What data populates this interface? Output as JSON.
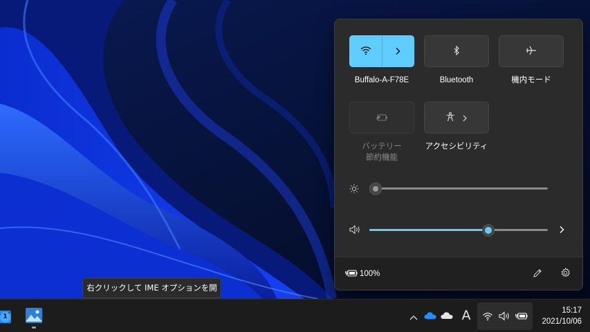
{
  "quick_settings": {
    "tiles": {
      "wifi": {
        "label": "Buffalo-A-F78E",
        "state": "on"
      },
      "bluetooth": {
        "label": "Bluetooth",
        "state": "off"
      },
      "airplane": {
        "label": "機内モード",
        "state": "off"
      },
      "battery_saver": {
        "label_line1": "バッテリー",
        "label_line2": "節約機能",
        "state": "disabled"
      },
      "accessibility": {
        "label": "アクセシビリティ",
        "state": "off"
      }
    },
    "brightness": {
      "level": 0
    },
    "volume": {
      "level": 0.68
    },
    "battery": {
      "percent": "100%"
    }
  },
  "tooltip": {
    "text": "右クリックして IME オプションを開きます"
  },
  "taskbar": {
    "mail_badge": "1",
    "ime_mode": "A",
    "clock": {
      "time": "15:17",
      "date": "2021/10/06"
    }
  },
  "colors": {
    "accent": "#60cdff",
    "flyout_bg": "#2b2b2b",
    "taskbar_bg": "#1c1c1c"
  }
}
